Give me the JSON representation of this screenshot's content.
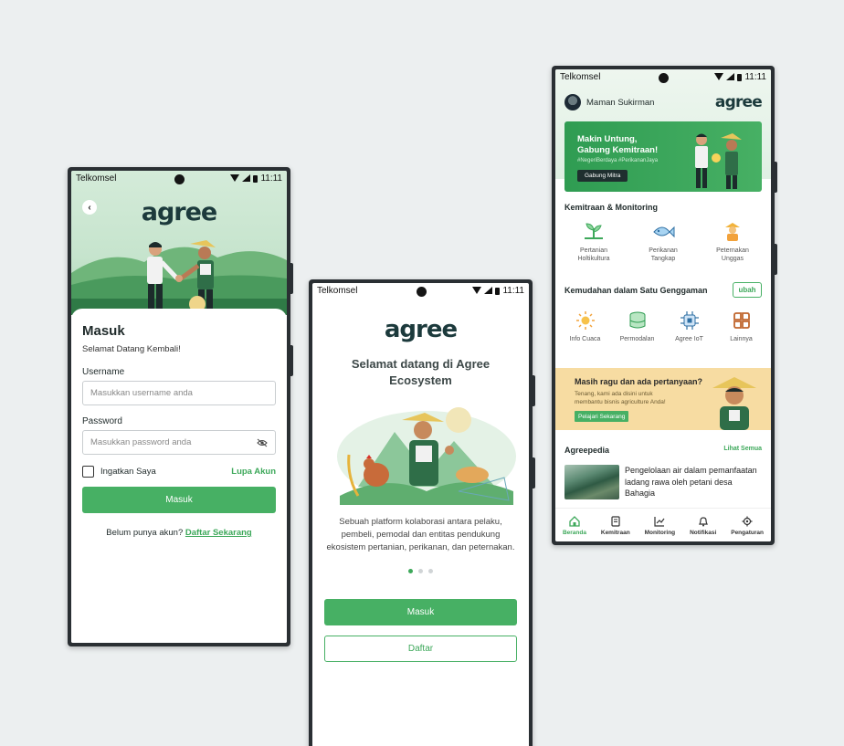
{
  "colors": {
    "brand_green": "#47b064",
    "dark_teal": "#1c3a3c",
    "background": "#eceff0",
    "help_banner": "#f7dca2"
  },
  "statusbar": {
    "carrier": "Telkomsel",
    "time": "11:11"
  },
  "login": {
    "logo": "agree",
    "title": "Masuk",
    "subtitle": "Selamat Datang Kembali!",
    "username_label": "Username",
    "username_placeholder": "Masukkan username anda",
    "password_label": "Password",
    "password_placeholder": "Masukkan password anda",
    "remember_label": "Ingatkan Saya",
    "forgot_label": "Lupa Akun",
    "submit_label": "Masuk",
    "signup_prompt": "Belum punya akun?",
    "signup_link": "Daftar Sekarang"
  },
  "welcome": {
    "logo": "agree",
    "title": "Selamat datang di Agree Ecosystem",
    "description": "Sebuah platform kolaborasi antara pelaku, pembeli, pemodal dan entitas pendukung ekosistem pertanian, perikanan, dan peternakan.",
    "page_dots": {
      "count": 3,
      "active": 1
    },
    "login_label": "Masuk",
    "register_label": "Daftar"
  },
  "home": {
    "user_name": "Maman Sukirman",
    "logo": "agree",
    "banner": {
      "line1": "Makin Untung,",
      "line2": "Gabung Kemitraan!",
      "tags": "#NegeriBerdaya #PerikananJaya",
      "button": "Gabung Mitra"
    },
    "partnership_title": "Kemitraan & Monitoring",
    "partnership_items": [
      {
        "line1": "Pertanian",
        "line2": "Holtikultura",
        "icon": "plant-icon"
      },
      {
        "line1": "Perikanan",
        "line2": "Tangkap",
        "icon": "fish-icon"
      },
      {
        "line1": "Peternakan",
        "line2": "Unggas",
        "icon": "farmer-icon"
      }
    ],
    "convenience_title": "Kemudahan dalam Satu Genggaman",
    "convenience_edit": "ubah",
    "convenience_items": [
      {
        "label": "Info Cuaca",
        "icon": "sun-icon"
      },
      {
        "label": "Permodalan",
        "icon": "database-icon"
      },
      {
        "label": "Agree IoT",
        "icon": "chip-icon"
      },
      {
        "label": "Lainnya",
        "icon": "grid-icon"
      }
    ],
    "help": {
      "title": "Masih ragu dan ada pertanyaan?",
      "line1": "Tenang, kami ada disini untuk",
      "line2": "membantu bisnis agriculture Anda!",
      "button": "Pelajari Sekarang"
    },
    "agreepedia_title": "Agreepedia",
    "agreepedia_see_all": "Lihat Semua",
    "article_title": "Pengelolaan air dalam pemanfaatan ladang rawa oleh petani desa Bahagia",
    "nav": [
      {
        "label": "Beranda",
        "icon": "home-icon",
        "active": true
      },
      {
        "label": "Kemitraan",
        "icon": "document-icon",
        "active": false
      },
      {
        "label": "Monitoring",
        "icon": "chart-icon",
        "active": false
      },
      {
        "label": "Notifikasi",
        "icon": "bell-icon",
        "active": false
      },
      {
        "label": "Pengaturan",
        "icon": "gear-icon",
        "active": false
      }
    ]
  }
}
